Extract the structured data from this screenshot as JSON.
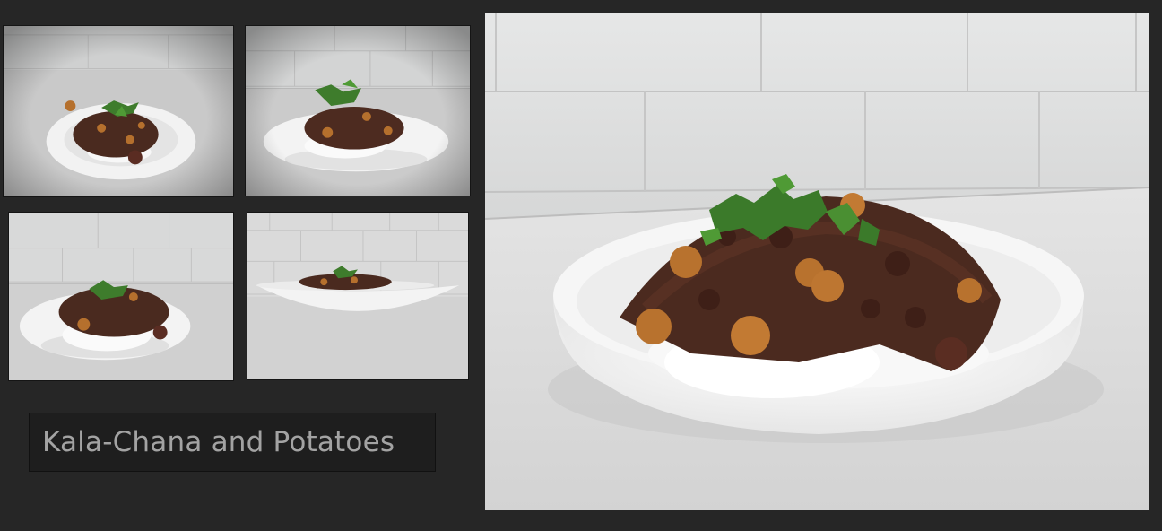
{
  "gallery": {
    "title": "Kala-Chana and Potatoes",
    "thumbnails": [
      {
        "name": "thumbnail-top-down-view"
      },
      {
        "name": "thumbnail-angled-view"
      },
      {
        "name": "thumbnail-side-angle-view"
      },
      {
        "name": "thumbnail-low-side-view"
      }
    ],
    "featured": {
      "name": "featured-photo-side-view"
    }
  },
  "colors": {
    "background": "#262626",
    "title_text": "#a3a3a3",
    "title_box": "#1e1e1e"
  }
}
